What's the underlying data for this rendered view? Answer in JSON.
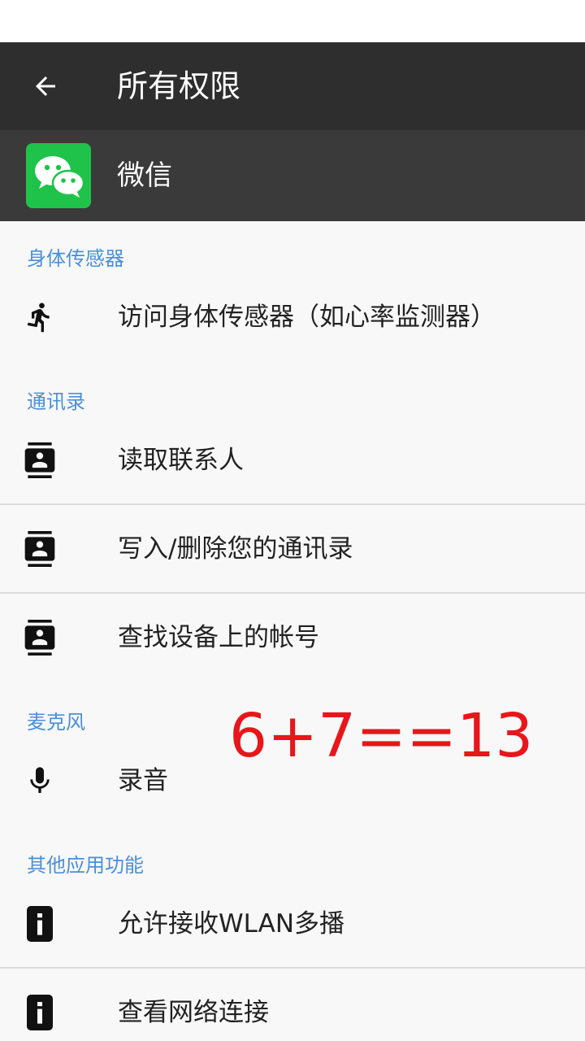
{
  "toolbar": {
    "title": "所有权限",
    "back_icon": "arrow-back-icon"
  },
  "app": {
    "name": "微信",
    "icon": "wechat-icon",
    "icon_color": "#1fc34a"
  },
  "sections": {
    "body_sensors": {
      "header": "身体传感器",
      "items": [
        "访问身体传感器（如心率监测器）"
      ]
    },
    "contacts": {
      "header": "通讯录",
      "items": [
        "读取联系人",
        "写入/删除您的通讯录",
        "查找设备上的帐号"
      ]
    },
    "microphone": {
      "header": "麦克风",
      "items": [
        "录音"
      ]
    },
    "other": {
      "header": "其他应用功能",
      "items": [
        "允许接收WLAN多播",
        "查看网络连接"
      ]
    }
  },
  "overlay_text": "6+7==13",
  "colors": {
    "section_header": "#4a8fd9",
    "toolbar": "#2e2e2e",
    "app_header": "#3a3a3a",
    "overlay": "#e8161a"
  }
}
